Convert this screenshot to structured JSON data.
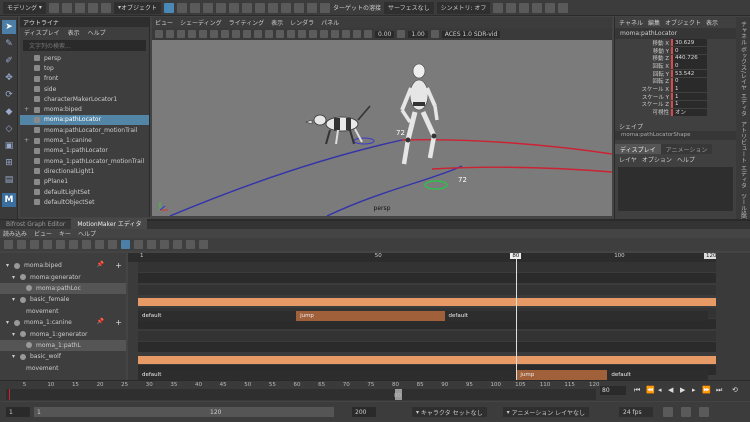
{
  "topbar": {
    "mode": "モデリング",
    "object_mode": "オブジェクト",
    "target_weld_label": "ターゲットの溶接",
    "symmetry": "シンメトリ: オフ",
    "surface": "サーフェスなし"
  },
  "outliner": {
    "title": "アウトライナ",
    "menu": [
      "ディスプレイ",
      "表示",
      "ヘルプ"
    ],
    "search_placeholder": "文字列の検索...",
    "items": [
      {
        "label": "persp",
        "selected": false,
        "icon": "camera-icon"
      },
      {
        "label": "top",
        "selected": false,
        "icon": "camera-icon"
      },
      {
        "label": "front",
        "selected": false,
        "icon": "camera-icon"
      },
      {
        "label": "side",
        "selected": false,
        "icon": "camera-icon"
      },
      {
        "label": "characterMakerLocator1",
        "selected": false,
        "icon": "locator-icon"
      },
      {
        "label": "moma:biped",
        "selected": false,
        "icon": "group-icon"
      },
      {
        "label": "moma:pathLocator",
        "selected": true,
        "icon": "locator-icon"
      },
      {
        "label": "moma:pathLocator_motionTrail",
        "selected": false,
        "icon": "trail-icon"
      },
      {
        "label": "moma_1:canine",
        "selected": false,
        "icon": "group-icon"
      },
      {
        "label": "moma_1:pathLocator",
        "selected": false,
        "icon": "locator-icon"
      },
      {
        "label": "moma_1:pathLocator_motionTrail",
        "selected": false,
        "icon": "trail-icon"
      },
      {
        "label": "directionalLight1",
        "selected": false,
        "icon": "light-icon"
      },
      {
        "label": "pPlane1",
        "selected": false,
        "icon": "mesh-icon"
      },
      {
        "label": "defaultLightSet",
        "selected": false,
        "icon": "set-icon"
      },
      {
        "label": "defaultObjectSet",
        "selected": false,
        "icon": "set-icon"
      }
    ]
  },
  "viewport": {
    "menu": [
      "ビュー",
      "シェーディング",
      "ライティング",
      "表示",
      "レンダラ",
      "パネル"
    ],
    "camera_label": "persp",
    "value_a": "0.00",
    "value_b": "1.00",
    "color_space": "ACES 1.0 SDR-vid",
    "path_labels": [
      "72",
      "72"
    ]
  },
  "attribute_editor": {
    "menu": [
      "チャネル",
      "編集",
      "オブジェクト",
      "表示"
    ],
    "object_name": "moma:pathLocator",
    "attributes": [
      {
        "label": "移動 X",
        "value": "30.629"
      },
      {
        "label": "移動 Y",
        "value": "0"
      },
      {
        "label": "移動 Z",
        "value": "440.726"
      },
      {
        "label": "回転 X",
        "value": "0"
      },
      {
        "label": "回転 Y",
        "value": "53.542"
      },
      {
        "label": "回転 Z",
        "value": "0"
      },
      {
        "label": "スケール X",
        "value": "1"
      },
      {
        "label": "スケール Y",
        "value": "1"
      },
      {
        "label": "スケール Z",
        "value": "1"
      },
      {
        "label": "可視性",
        "value": "オン"
      }
    ],
    "shape_section": "シェイプ",
    "shape_name": "moma:pathLocatorShape",
    "tabs": [
      "ディスプレイ",
      "アニメーション"
    ],
    "layer_menu": [
      "レイヤ",
      "オプション",
      "ヘルプ"
    ],
    "side_labels": [
      "チャネル ボックス/レイヤ エディタ",
      "アトリビュート エディタ",
      "ツール設定"
    ]
  },
  "editor_tabs": {
    "inactive": "Bifrost Graph Editor",
    "active": "MotionMaker エディタ"
  },
  "motionmaker": {
    "menu": [
      "読み込み",
      "ビュー",
      "キー",
      "ヘルプ"
    ],
    "tracks": [
      {
        "label": "moma:biped",
        "level": 0
      },
      {
        "label": "moma:generator",
        "level": 1
      },
      {
        "label": "moma:pathLoc",
        "level": 2
      },
      {
        "label": "basic_female",
        "level": 1
      },
      {
        "label": "movement",
        "level": 2
      },
      {
        "label": "moma_1:canine",
        "level": 0
      },
      {
        "label": "moma_1:generator",
        "level": 1
      },
      {
        "label": "moma_1:pathL",
        "level": 2
      },
      {
        "label": "basic_wolf",
        "level": 1
      },
      {
        "label": "movement",
        "level": 2
      }
    ],
    "ruler": {
      "start": "1",
      "mid": "50",
      "end_marker": "100",
      "end": "120",
      "current": "80"
    },
    "clips_female": [
      {
        "label": "default",
        "start": 1,
        "end": 34
      },
      {
        "label": "jump",
        "start": 34,
        "end": 65
      },
      {
        "label": "default",
        "start": 65,
        "end": 120
      }
    ],
    "clips_wolf": [
      {
        "label": "default",
        "start": 1,
        "end": 80
      },
      {
        "label": "jump",
        "start": 80,
        "end": 99
      },
      {
        "label": "default",
        "start": 99,
        "end": 120
      }
    ]
  },
  "time_slider": {
    "ticks": [
      "5",
      "10",
      "15",
      "20",
      "25",
      "30",
      "35",
      "40",
      "45",
      "50",
      "55",
      "60",
      "65",
      "70",
      "75",
      "80",
      "85",
      "90",
      "95",
      "100",
      "105",
      "110",
      "115",
      "120"
    ],
    "current_marker": "80",
    "current_field": "80"
  },
  "range_bar": {
    "start": "1",
    "range_start": "1",
    "range_end": "120",
    "anim_end": "200",
    "character_set": "キャラクタ セットなし",
    "anim_layer": "アニメーション レイヤなし",
    "fps": "24 fps"
  },
  "colors": {
    "selection": "#5285a6",
    "clip_orange": "#e89a66",
    "clip_brown": "#a0603a",
    "path_red": "#cc2233",
    "path_blue": "#3333aa",
    "viewport_bg": "#7a7a7a"
  }
}
